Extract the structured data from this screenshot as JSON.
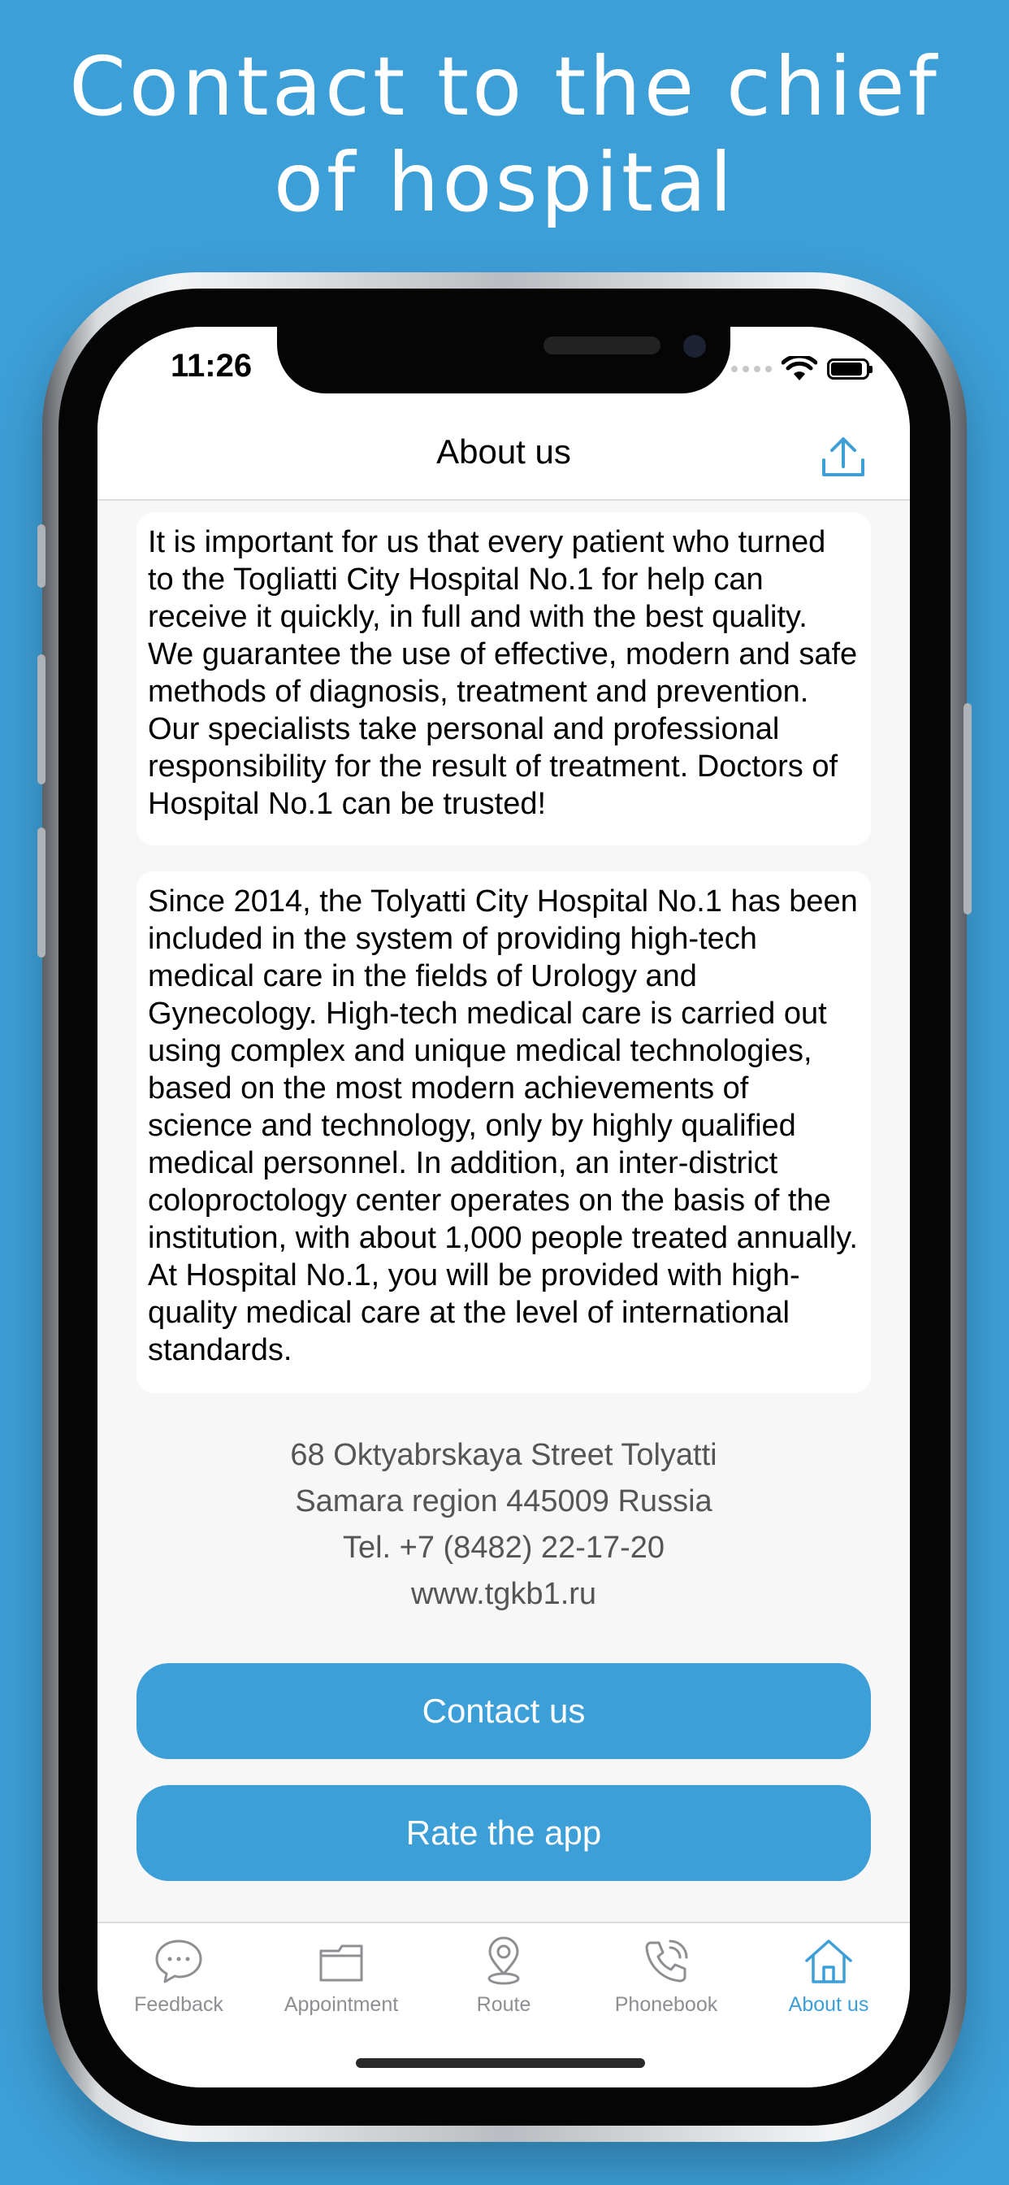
{
  "promo": {
    "headline_line1": "Contact to the chief",
    "headline_line2": "of hospital"
  },
  "status_bar": {
    "time": "11:26"
  },
  "navbar": {
    "title": "About us",
    "share_icon": "share-icon"
  },
  "cards": [
    {
      "text": "It is important for us that every patient who turned to the Togliatti City Hospital No.1 for help can receive it quickly, in full and with the best quality. We guarantee the use of effective, modern and safe methods of diagnosis, treatment and prevention. Our specialists take personal and professional responsibility for the result of treatment. Doctors of Hospital No.1 can be trusted!"
    },
    {
      "text": "Since 2014, the Tolyatti City Hospital No.1 has been included in the system of providing high-tech medical care in the fields of Urology and Gynecology. High-tech medical care is carried out using complex and unique medical technologies, based on the most modern achievements of science and technology, only by highly qualified medical personnel. In addition, an inter-district coloproctology center operates on the basis of the institution, with about 1,000 people treated annually. At Hospital No.1, you will be provided with high-quality medical care at the level of international standards."
    }
  ],
  "contact_info": {
    "address_line1": "68 Oktyabrskaya Street Tolyatti",
    "address_line2": "Samara region 445009 Russia",
    "phone": "Tel. +7 (8482) 22-17-20",
    "website": "www.tgkb1.ru"
  },
  "buttons": {
    "contact": "Contact us",
    "rate": "Rate the app"
  },
  "tabs": [
    {
      "label": "Feedback",
      "icon": "chat-bubble-icon",
      "active": false
    },
    {
      "label": "Appointment",
      "icon": "folder-icon",
      "active": false
    },
    {
      "label": "Route",
      "icon": "location-pin-icon",
      "active": false
    },
    {
      "label": "Phonebook",
      "icon": "phone-icon",
      "active": false
    },
    {
      "label": "About us",
      "icon": "home-icon",
      "active": true
    }
  ],
  "colors": {
    "accent": "#3d9fd8",
    "inactive": "#8e8e93",
    "background": "#f7f7f7"
  }
}
